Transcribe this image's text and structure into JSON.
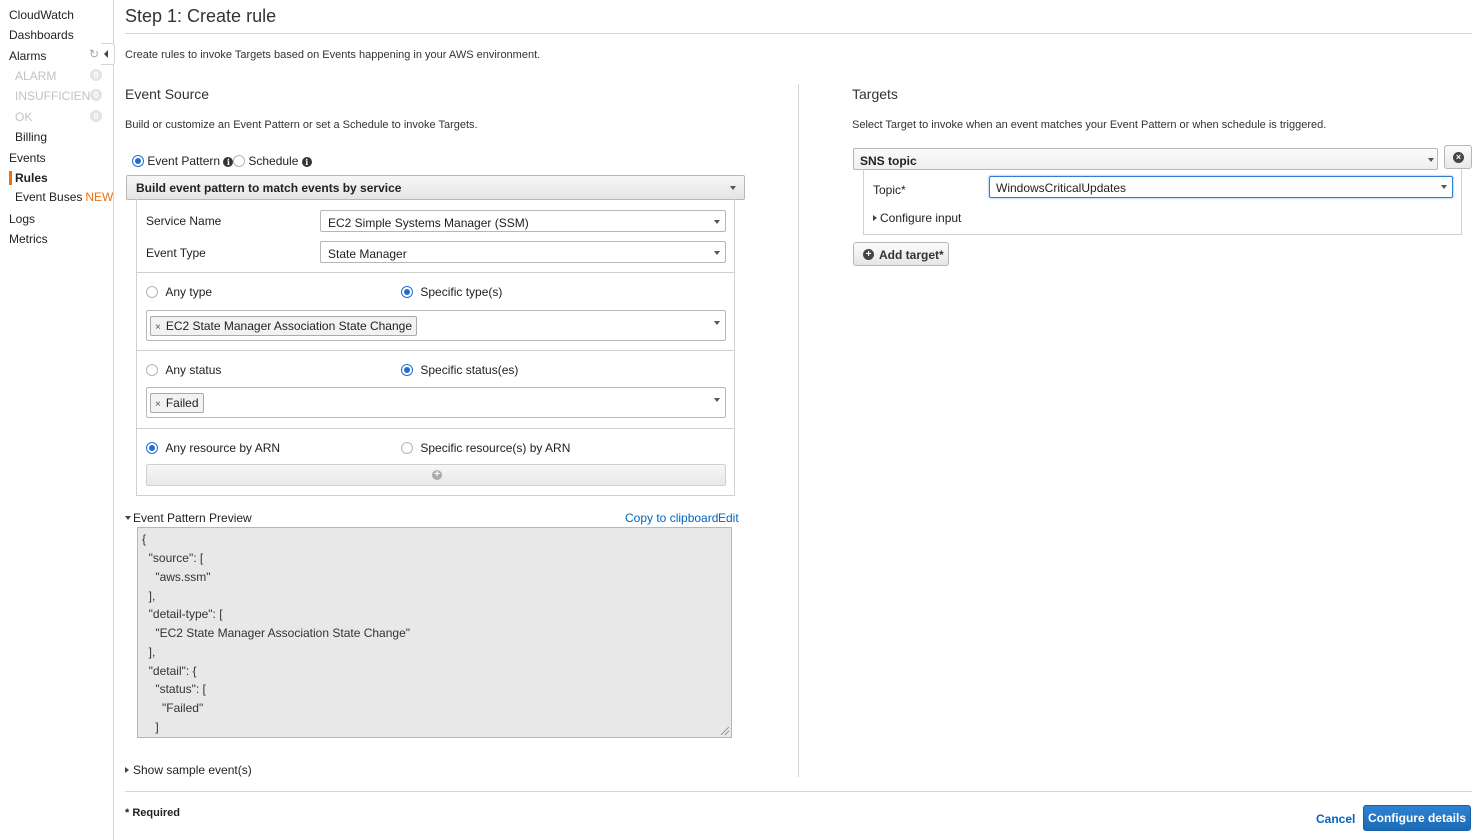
{
  "sidebar": {
    "items": [
      {
        "label": "CloudWatch"
      },
      {
        "label": "Dashboards"
      },
      {
        "label": "Alarms"
      },
      {
        "label": "ALARM",
        "count": "0"
      },
      {
        "label": "INSUFFICIENT",
        "count": "0"
      },
      {
        "label": "OK",
        "count": "0"
      },
      {
        "label": "Billing"
      },
      {
        "label": "Events"
      },
      {
        "label": "Rules"
      },
      {
        "label": "Event Buses",
        "tag": "NEW"
      },
      {
        "label": "Logs"
      },
      {
        "label": "Metrics"
      }
    ],
    "accent_color": "#ec7211"
  },
  "page": {
    "title": "Step 1: Create rule",
    "intro": "Create rules to invoke Targets based on Events happening in your AWS environment."
  },
  "event_source": {
    "heading": "Event Source",
    "description": "Build or customize an Event Pattern or set a Schedule to invoke Targets.",
    "mode_options": [
      {
        "label": "Event Pattern",
        "selected": true
      },
      {
        "label": "Schedule",
        "selected": false
      }
    ],
    "builder_label": "Build event pattern to match events by service",
    "service_name_label": "Service Name",
    "service_name_value": "EC2 Simple Systems Manager (SSM)",
    "event_type_label": "Event Type",
    "event_type_value": "State Manager",
    "type_options": [
      {
        "label": "Any type",
        "selected": false
      },
      {
        "label": "Specific type(s)",
        "selected": true
      }
    ],
    "type_chip": "EC2 State Manager Association State Change",
    "status_options": [
      {
        "label": "Any status",
        "selected": false
      },
      {
        "label": "Specific status(es)",
        "selected": true
      }
    ],
    "status_chip": "Failed",
    "resource_options": [
      {
        "label": "Any resource by ARN",
        "selected": true
      },
      {
        "label": "Specific resource(s) by ARN",
        "selected": false
      }
    ],
    "preview_label": "Event Pattern Preview",
    "copy_link": "Copy to clipboard",
    "edit_link": "Edit",
    "preview_lines": [
      "{",
      "  \"source\": [",
      "    \"aws.ssm\"",
      "  ],",
      "  \"detail-type\": [",
      "    \"EC2 State Manager Association State Change\"",
      "  ],",
      "  \"detail\": {",
      "    \"status\": [",
      "      \"Failed\"",
      "    ]",
      "  }"
    ],
    "show_sample": "Show sample event(s)"
  },
  "targets": {
    "heading": "Targets",
    "description": "Select Target to invoke when an event matches your Event Pattern or when schedule is triggered.",
    "target_type": "SNS topic",
    "topic_label": "Topic*",
    "topic_value": "WindowsCriticalUpdates",
    "configure_input": "Configure input",
    "add_target": "Add target*"
  },
  "footer": {
    "required_note": "* Required",
    "cancel": "Cancel",
    "configure_details": "Configure details",
    "primary_color": "#1f6fbf"
  }
}
